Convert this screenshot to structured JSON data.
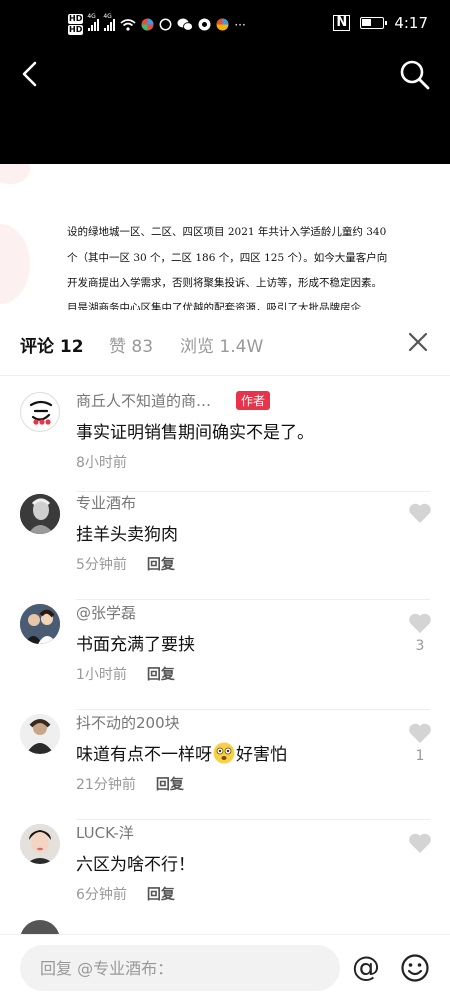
{
  "status_bar": {
    "hd_labels": [
      "HD",
      "HD"
    ],
    "net1": "4G",
    "net2": "4G",
    "time": "4:17",
    "nfc": "N",
    "more": "···",
    "battery_level": 0.45
  },
  "nav": {
    "back_icon": "chevron-left-icon",
    "search_icon": "search-icon"
  },
  "document": {
    "lines": [
      "设的绿地城一区、二区、四区项目 2021 年共计入学适龄儿童约 340",
      "个（其中一区 30 个，二区 186 个，四区 125 个）。如今大量客户向",
      "开发商提出入学需求，否则将聚集投诉、上访等，形成不稳定因素。",
      "目是湖商务中心区集中了优越的配套资源，吸引了大批品牌房企"
    ]
  },
  "tabs": [
    {
      "label": "评论 12",
      "active": true
    },
    {
      "label": "赞 83",
      "active": false
    },
    {
      "label": "浏览 1.4W",
      "active": false
    }
  ],
  "comments": [
    {
      "username": "商丘人不知道的商…",
      "badge": "作者",
      "text": "事实证明销售期间确实不是了。",
      "time": "8小时前",
      "reply": "",
      "likes": ""
    },
    {
      "username": "专业酒布",
      "badge": "",
      "text": "挂羊头卖狗肉",
      "time": "5分钟前",
      "reply": "回复",
      "likes": ""
    },
    {
      "username": "@张学磊",
      "badge": "",
      "text": "书面充满了要挟",
      "time": "1小时前",
      "reply": "回复",
      "likes": "3"
    },
    {
      "username": "抖不动的200块",
      "badge": "",
      "text_before": "味道有点不一样呀",
      "text_after": "好害怕",
      "time": "21分钟前",
      "reply": "回复",
      "likes": "1"
    },
    {
      "username": "LUCK-洋",
      "badge": "",
      "text": "六区为啥不行！",
      "time": "6分钟前",
      "reply": "回复",
      "likes": ""
    }
  ],
  "reply_bar": {
    "placeholder": "回复 @专业酒布：",
    "at_symbol": "@"
  },
  "colors": {
    "badge": "#e8334a",
    "like_icon": "#d4d4d4"
  }
}
